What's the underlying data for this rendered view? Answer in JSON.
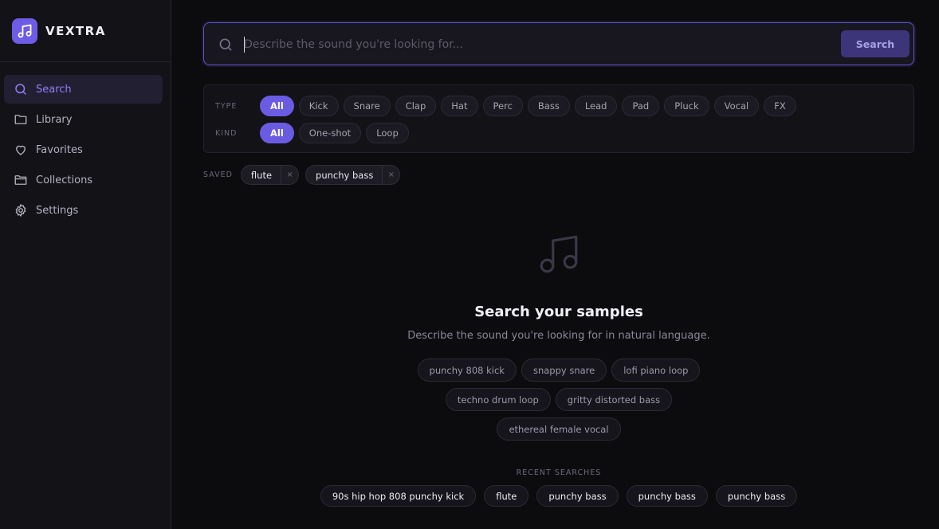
{
  "brand": {
    "name": "VEXTRA",
    "logo_icon": "music-note-icon",
    "accent": "#6d5ce6"
  },
  "sidebar": {
    "items": [
      {
        "label": "Search",
        "icon": "search-icon",
        "active": true
      },
      {
        "label": "Library",
        "icon": "folder-icon",
        "active": false
      },
      {
        "label": "Favorites",
        "icon": "heart-icon",
        "active": false
      },
      {
        "label": "Collections",
        "icon": "folder-open-icon",
        "active": false
      },
      {
        "label": "Settings",
        "icon": "gear-icon",
        "active": false
      }
    ]
  },
  "search": {
    "placeholder": "Describe the sound you're looking for...",
    "value": "",
    "button_label": "Search"
  },
  "filters": {
    "type_label": "TYPE",
    "type_options": [
      "All",
      "Kick",
      "Snare",
      "Clap",
      "Hat",
      "Perc",
      "Bass",
      "Lead",
      "Pad",
      "Pluck",
      "Vocal",
      "FX"
    ],
    "type_selected": "All",
    "kind_label": "KIND",
    "kind_options": [
      "All",
      "One-shot",
      "Loop"
    ],
    "kind_selected": "All"
  },
  "saved": {
    "label": "SAVED",
    "items": [
      "flute",
      "punchy bass"
    ],
    "remove_glyph": "×"
  },
  "empty_state": {
    "icon": "music-notes-icon",
    "title": "Search your samples",
    "subtitle": "Describe the sound you're looking for in natural language.",
    "suggestions": [
      "punchy 808 kick",
      "snappy snare",
      "lofi piano loop",
      "techno drum loop",
      "gritty distorted bass",
      "ethereal female vocal"
    ]
  },
  "recent": {
    "label": "RECENT SEARCHES",
    "items": [
      "90s hip hop 808 punchy kick",
      "flute",
      "punchy bass",
      "punchy bass",
      "punchy bass"
    ]
  }
}
